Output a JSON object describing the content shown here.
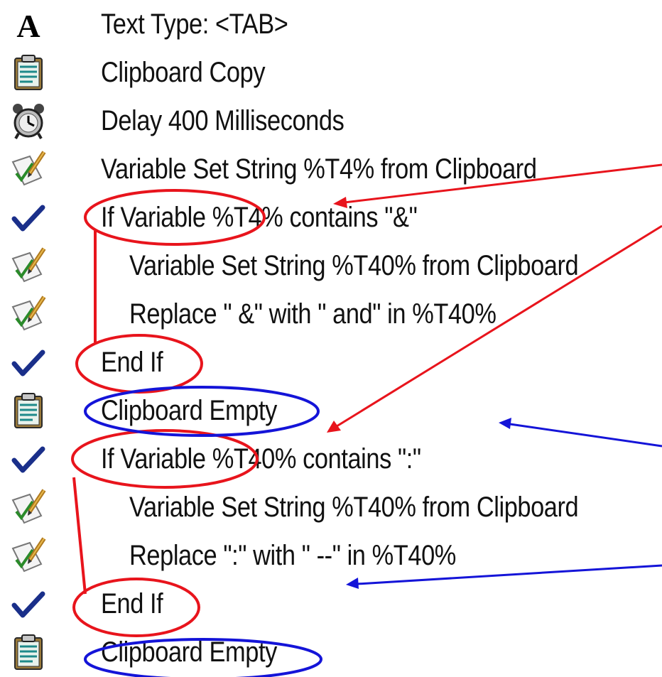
{
  "macro_steps": [
    {
      "icon": "text-type-icon",
      "label": "Text Type: <TAB>",
      "indent": 0
    },
    {
      "icon": "clipboard-icon",
      "label": "Clipboard Copy",
      "indent": 0
    },
    {
      "icon": "alarm-clock-icon",
      "label": "Delay 400 Milliseconds",
      "indent": 0
    },
    {
      "icon": "variable-edit-icon",
      "label": "Variable Set String %T4% from Clipboard",
      "indent": 0
    },
    {
      "icon": "checkmark-icon",
      "label": "If Variable %T4% contains \"&\"",
      "indent": 0
    },
    {
      "icon": "variable-edit-icon",
      "label": "Variable Set String %T40% from Clipboard",
      "indent": 1
    },
    {
      "icon": "variable-edit-icon",
      "label": "Replace \" &\" with \" and\" in %T40%",
      "indent": 1
    },
    {
      "icon": "checkmark-icon",
      "label": "End If",
      "indent": 0
    },
    {
      "icon": "clipboard-icon",
      "label": "Clipboard Empty",
      "indent": 0
    },
    {
      "icon": "checkmark-icon",
      "label": "If Variable %T40% contains \":\"",
      "indent": 0
    },
    {
      "icon": "variable-edit-icon",
      "label": "Variable Set String %T40% from Clipboard",
      "indent": 1
    },
    {
      "icon": "variable-edit-icon",
      "label": "Replace \":\" with \" --\" in %T40%",
      "indent": 1
    },
    {
      "icon": "checkmark-icon",
      "label": "End If",
      "indent": 0
    },
    {
      "icon": "clipboard-icon",
      "label": "Clipboard Empty",
      "indent": 0
    }
  ],
  "annotation_colors": {
    "if_block": "#e8141c",
    "clipboard_empty": "#1414d8"
  }
}
